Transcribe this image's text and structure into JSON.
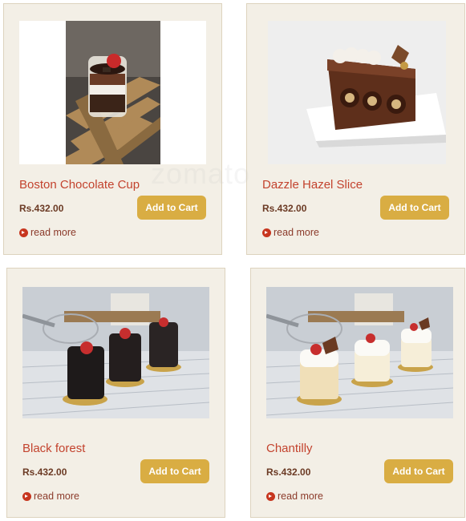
{
  "products": [
    {
      "title": "Boston Chocolate Cup",
      "price": "Rs.432.00",
      "cart_label": "Add to Cart",
      "more_label": "read more"
    },
    {
      "title": "Dazzle Hazel Slice",
      "price": "Rs.432.00",
      "cart_label": "Add to Cart",
      "more_label": "read more"
    },
    {
      "title": "Black forest",
      "price": "Rs.432.00",
      "cart_label": "Add to Cart",
      "more_label": "read more"
    },
    {
      "title": "Chantilly",
      "price": "Rs.432.00",
      "cart_label": "Add to Cart",
      "more_label": "read more"
    }
  ],
  "watermark": "zomato",
  "colors": {
    "title": "#c3432e",
    "price": "#6b3a24",
    "button": "#d9ad43",
    "card": "#f3efe6"
  },
  "icons": {
    "read_more": "circle-arrow-right-icon"
  }
}
